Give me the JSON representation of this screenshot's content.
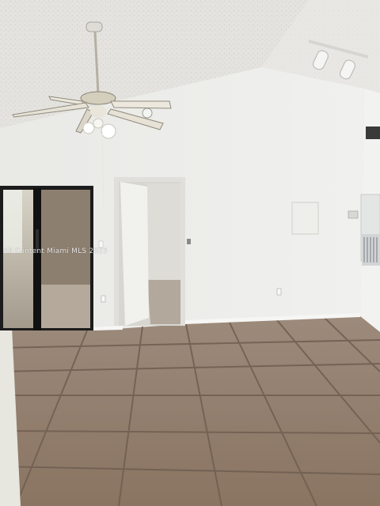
{
  "photo": {
    "subject": "empty-room-interior",
    "watermark_text": "All Content Miami MLS 2025"
  },
  "colors": {
    "ceiling": "#e6e5e1",
    "wall": "#ebebe8",
    "floor_tile": "#8c7766",
    "grout": "#6e5d50",
    "door_frame": "#e2e1dd",
    "slider_frame": "#1b1b1b"
  }
}
